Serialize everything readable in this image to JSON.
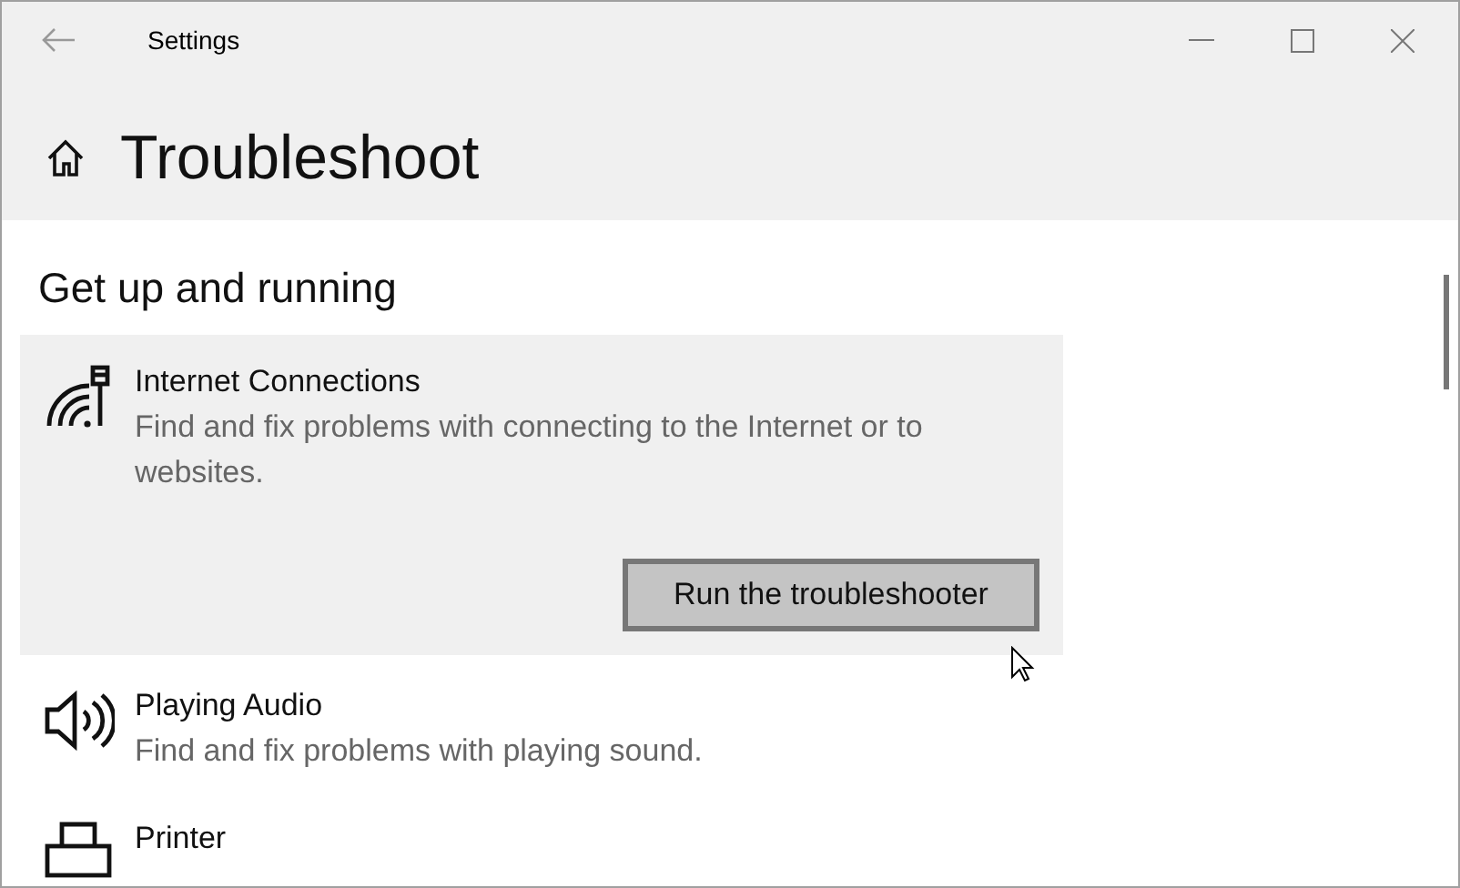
{
  "window": {
    "title": "Settings"
  },
  "page": {
    "title": "Troubleshoot"
  },
  "section": {
    "title": "Get up and running"
  },
  "items": [
    {
      "kind": "network",
      "title": "Internet Connections",
      "description": "Find and fix problems with connecting to the Internet or to websites.",
      "expanded": true,
      "button": "Run the troubleshooter"
    },
    {
      "kind": "audio",
      "title": "Playing Audio",
      "description": "Find and fix problems with playing sound.",
      "expanded": false
    },
    {
      "kind": "printer",
      "title": "Printer",
      "expanded": false
    }
  ]
}
